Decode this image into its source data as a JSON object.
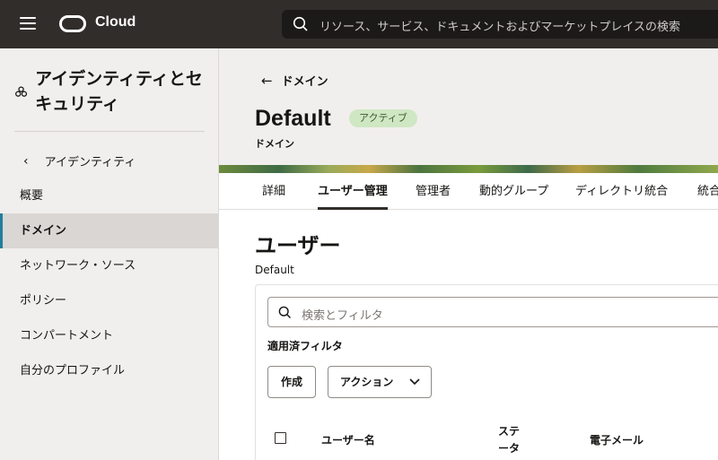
{
  "topbar": {
    "brand": "Cloud",
    "search_placeholder": "リソース、サービス、ドキュメントおよびマーケットプレイスの検索",
    "icons": [
      "hamburger-icon",
      "oracle-logo",
      "search-icon"
    ]
  },
  "sidebar": {
    "title": "アイデンティティとセキュリティ",
    "back_label": "アイデンティティ",
    "items": [
      {
        "label": "概要"
      },
      {
        "label": "ドメイン",
        "active": true
      },
      {
        "label": "ネットワーク・ソース"
      },
      {
        "label": "ポリシー"
      },
      {
        "label": "コンパートメント"
      },
      {
        "label": "自分のプロファイル"
      }
    ]
  },
  "header": {
    "back_label": "ドメイン",
    "title": "Default",
    "status_badge": "アクティブ",
    "subtitle": "ドメイン"
  },
  "tabs": [
    {
      "label": "詳細"
    },
    {
      "label": "ユーザー管理",
      "active": true
    },
    {
      "label": "管理者"
    },
    {
      "label": "動的グループ"
    },
    {
      "label": "ディレクトリ統合"
    },
    {
      "label": "統合"
    }
  ],
  "users_section": {
    "title": "ユーザー",
    "subtitle": "Default",
    "filter_placeholder": "検索とフィルタ",
    "applied_filters_label": "適用済フィルタ",
    "create_button": "作成",
    "actions_button": "アクション",
    "columns": [
      "ユーザー名",
      "ステータス",
      "電子メール"
    ]
  },
  "colors": {
    "topbar_bg": "#312d2a",
    "active_accent": "#227e9e",
    "badge_bg": "#cfe7c3"
  }
}
